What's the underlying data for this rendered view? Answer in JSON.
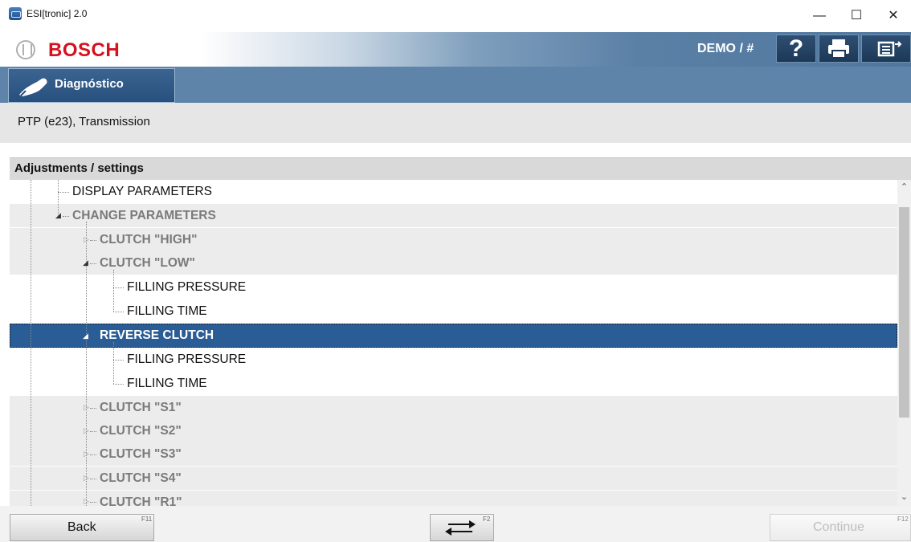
{
  "window": {
    "title": "ESI[tronic] 2.0",
    "minimize": "—",
    "maximize": "☐",
    "close": "✕"
  },
  "header": {
    "brand": "BOSCH",
    "mode": "DEMO / #",
    "help": "?"
  },
  "tabs": [
    {
      "label": "Diagnóstico",
      "icon": "plug-icon"
    }
  ],
  "breadcrumb": "PTP (e23), Transmission",
  "panel": {
    "title": "Adjustments / settings"
  },
  "tree": [
    {
      "label": "DISPLAY PARAMETERS",
      "level": 1,
      "style": "normal",
      "expander": "none"
    },
    {
      "label": "CHANGE PARAMETERS",
      "level": 1,
      "style": "dim",
      "expander": "open"
    },
    {
      "label": "CLUTCH \"HIGH\"",
      "level": 2,
      "style": "dim",
      "expander": "closed"
    },
    {
      "label": "CLUTCH \"LOW\"",
      "level": 2,
      "style": "dim",
      "expander": "open"
    },
    {
      "label": "FILLING PRESSURE",
      "level": 3,
      "style": "normal",
      "expander": "none"
    },
    {
      "label": "FILLING TIME",
      "level": 3,
      "style": "normal",
      "expander": "none"
    },
    {
      "label": "REVERSE CLUTCH",
      "level": 2,
      "style": "selected",
      "expander": "open"
    },
    {
      "label": "FILLING PRESSURE",
      "level": 3,
      "style": "normal",
      "expander": "none"
    },
    {
      "label": "FILLING TIME",
      "level": 3,
      "style": "normal",
      "expander": "none"
    },
    {
      "label": "CLUTCH \"S1\"",
      "level": 2,
      "style": "dim",
      "expander": "closed"
    },
    {
      "label": "CLUTCH \"S2\"",
      "level": 2,
      "style": "dim",
      "expander": "closed"
    },
    {
      "label": "CLUTCH \"S3\"",
      "level": 2,
      "style": "dim",
      "expander": "closed"
    },
    {
      "label": "CLUTCH \"S4\"",
      "level": 2,
      "style": "dim",
      "expander": "closed"
    },
    {
      "label": "CLUTCH \"R1\"",
      "level": 2,
      "style": "dim",
      "expander": "closed"
    }
  ],
  "footer": {
    "back": "Back",
    "back_key": "F11",
    "swap_key": "F2",
    "continue": "Continue",
    "continue_key": "F12"
  },
  "colors": {
    "accent": "#2a5d95",
    "brand_red": "#d4121e"
  }
}
